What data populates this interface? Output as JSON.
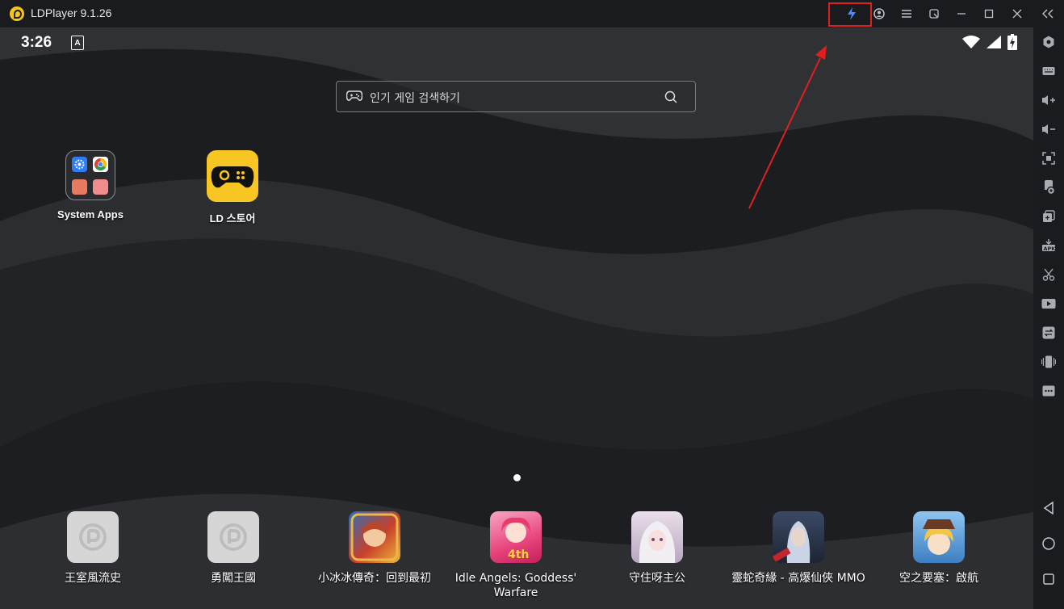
{
  "window": {
    "title": "LDPlayer 9.1.26",
    "controls": [
      "lightning-turbo-icon",
      "account-icon",
      "menu-icon",
      "resize-icon",
      "minimize-icon",
      "maximize-icon",
      "close-icon",
      "collapse-sidebar-icon"
    ]
  },
  "status_bar": {
    "time": "3:26",
    "keyboard_badge": "A",
    "icons": [
      "wifi-icon",
      "signal-icon",
      "battery-charging-icon"
    ]
  },
  "search": {
    "placeholder": "인기 게임 검색하기"
  },
  "desktop": {
    "apps": [
      {
        "label": "System Apps"
      },
      {
        "label": "LD 스토어"
      }
    ]
  },
  "dock": {
    "apps": [
      {
        "label": "王室風流史"
      },
      {
        "label": "勇闖王國"
      },
      {
        "label": "小冰冰傳奇：回到最初"
      },
      {
        "label": "Idle Angels: Goddess' Warfare"
      },
      {
        "label": "守住呀主公"
      },
      {
        "label": "靈蛇奇緣 - 高爆仙俠 MMO"
      },
      {
        "label": "空之要塞：啟航"
      }
    ]
  },
  "sidebar": {
    "tools": [
      "settings-icon",
      "keyboard-mapping-icon",
      "volume-up-icon",
      "volume-down-icon",
      "screenshot-icon",
      "install-app-icon",
      "multi-instance-icon",
      "apk-icon",
      "scissors-icon",
      "record-video-icon",
      "sync-icon",
      "shake-icon",
      "more-icon"
    ],
    "nav": [
      "back-icon",
      "home-icon",
      "recent-apps-icon"
    ]
  },
  "colors": {
    "highlight_box": "#e02020",
    "turbo_icon": "#4a8cff",
    "ld_store_bg": "#f7c623"
  }
}
